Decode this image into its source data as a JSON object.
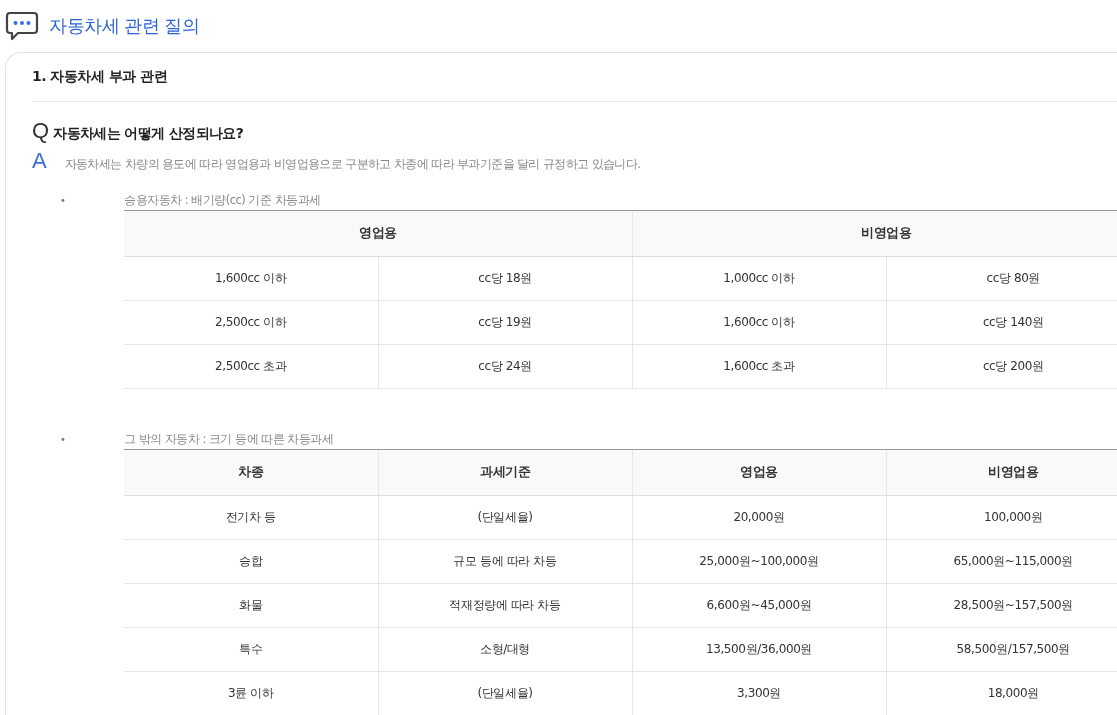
{
  "page_title": "자동차세 관련 질의",
  "section": {
    "title": "1. 자동차세 부과 관련",
    "question": {
      "mark": "Q",
      "text": "자동차세는 어떻게 산정되나요?"
    },
    "answer": {
      "mark": "A",
      "text": "자동차세는 차량의 용도에 따라 영업용과 비영업용으로 구분하고 차종에 따라 부과기준을 달리 규정하고 있습니다."
    },
    "items": [
      {
        "bullet": "•",
        "caption": "승용자동차 : 배기량(cc) 기준 차등과세",
        "table": {
          "header": [
            "영업용",
            "비영업용"
          ],
          "rows": [
            [
              "1,600cc 이하",
              "cc당 18원",
              "1,000cc 이하",
              "cc당 80원"
            ],
            [
              "2,500cc 이하",
              "cc당 19원",
              "1,600cc 이하",
              "cc당 140원"
            ],
            [
              "2,500cc 초과",
              "cc당 24원",
              "1,600cc 초과",
              "cc당 200원"
            ]
          ]
        }
      },
      {
        "bullet": "•",
        "caption": "그 밖의 자동차 : 크기 등에 따른 차등과세",
        "table": {
          "header": [
            "차종",
            "과세기준",
            "영업용",
            "비영업용"
          ],
          "rows": [
            [
              "전기차 등",
              "(단일세율)",
              "20,000원",
              "100,000원"
            ],
            [
              "승합",
              "규모 등에 따라 차등",
              "25,000원~100,000원",
              "65,000원~115,000원"
            ],
            [
              "화물",
              "적재정량에 따라 차등",
              "6,600원~45,000원",
              "28,500원~157,500원"
            ],
            [
              "특수",
              "소형/대형",
              "13,500원/36,000원",
              "58,500원/157,500원"
            ],
            [
              "3륜 이하",
              "(단일세율)",
              "3,300원",
              "18,000원"
            ]
          ]
        }
      }
    ]
  }
}
